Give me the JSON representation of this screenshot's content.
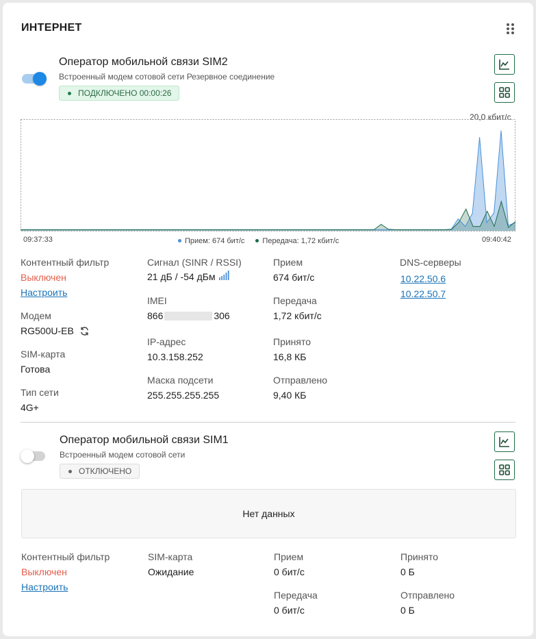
{
  "header": {
    "title": "ИНТЕРНЕТ"
  },
  "sim2": {
    "title": "Оператор мобильной связи SIM2",
    "subtitle": "Встроенный модем сотовой сети Резервное соединение",
    "status": "ПОДКЛЮЧЕНО 00:00:26",
    "enabled": true,
    "chart": {
      "max_label": "20,0 кбит/с",
      "start_time": "09:37:33",
      "end_time": "09:40:42",
      "legend": [
        {
          "label": "Прием:",
          "value": "674 бит/с",
          "color": "#4a90d9"
        },
        {
          "label": "Передача:",
          "value": "1,72 кбит/с",
          "color": "#1f6b47"
        }
      ]
    },
    "chart_data": {
      "type": "area",
      "ylim": [
        0,
        20
      ],
      "unit": "кбит/с",
      "series": [
        {
          "name": "Прием",
          "values": [
            0.2,
            0.2,
            0.2,
            0.2,
            0.2,
            0.2,
            0.2,
            0.2,
            0.2,
            0.2,
            0.2,
            0.2,
            0.2,
            0.2,
            0.2,
            0.2,
            0.2,
            0.2,
            0.2,
            0.2,
            0.2,
            0.2,
            0.2,
            0.2,
            0.2,
            0.2,
            0.2,
            0.2,
            0.2,
            0.2,
            0.2,
            0.2,
            0.2,
            0.2,
            0.2,
            0.2,
            0.2,
            0.2,
            0.2,
            0.2,
            0.2,
            0.2,
            0.2,
            0.2,
            0.2,
            0.2,
            0.2,
            0.2,
            0.2,
            0.2,
            0.2,
            0.2,
            0.2,
            0.2,
            0.2,
            0.2,
            0.2,
            0.2,
            0.2,
            0.2,
            0.2,
            2.2,
            0.8,
            3.2,
            17.2,
            1.5,
            3.3,
            18.4,
            1.0,
            1.5
          ]
        },
        {
          "name": "Передача",
          "values": [
            0.2,
            0.2,
            0.2,
            0.2,
            0.2,
            0.2,
            0.2,
            0.2,
            0.2,
            0.2,
            0.2,
            0.2,
            0.2,
            0.2,
            0.2,
            0.2,
            0.2,
            0.2,
            0.2,
            0.2,
            0.2,
            0.2,
            0.2,
            0.2,
            0.2,
            0.2,
            0.2,
            0.2,
            0.2,
            0.2,
            0.2,
            0.2,
            0.2,
            0.2,
            0.2,
            0.2,
            0.2,
            0.2,
            0.2,
            0.2,
            0.2,
            0.2,
            0.2,
            0.2,
            0.2,
            0.2,
            0.2,
            0.2,
            0.2,
            0.2,
            0.2,
            1.2,
            0.3,
            0.2,
            0.2,
            0.2,
            0.2,
            0.2,
            0.2,
            0.2,
            0.2,
            0.3,
            1.6,
            4.0,
            0.8,
            0.8,
            3.6,
            0.8,
            5.4,
            0.6,
            1.7
          ]
        }
      ]
    },
    "stats": {
      "content_filter": {
        "label": "Контентный фильтр",
        "value": "Выключен",
        "link": "Настроить"
      },
      "modem": {
        "label": "Модем",
        "value": "RG500U-EB"
      },
      "sim": {
        "label": "SIM-карта",
        "value": "Готова"
      },
      "net_type": {
        "label": "Тип сети",
        "value": "4G+"
      },
      "signal": {
        "label": "Сигнал (SINR / RSSI)",
        "value": "21 дБ / -54 дБм"
      },
      "imei": {
        "label": "IMEI",
        "prefix": "866",
        "suffix": "306"
      },
      "ip": {
        "label": "IP-адрес",
        "value": "10.3.158.252"
      },
      "mask": {
        "label": "Маска подсети",
        "value": "255.255.255.255"
      },
      "rx": {
        "label": "Прием",
        "value": "674 бит/с"
      },
      "tx": {
        "label": "Передача",
        "value": "1,72 кбит/с"
      },
      "received": {
        "label": "Принято",
        "value": "16,8 КБ"
      },
      "sent": {
        "label": "Отправлено",
        "value": "9,40 КБ"
      },
      "dns": {
        "label": "DNS-серверы",
        "servers": [
          "10.22.50.6",
          "10.22.50.7"
        ]
      }
    }
  },
  "sim1": {
    "title": "Оператор мобильной связи SIM1",
    "subtitle": "Встроенный модем сотовой сети",
    "status": "ОТКЛЮЧЕНО",
    "enabled": false,
    "nodata": "Нет данных",
    "stats": {
      "content_filter": {
        "label": "Контентный фильтр",
        "value": "Выключен",
        "link": "Настроить"
      },
      "sim": {
        "label": "SIM-карта",
        "value": "Ожидание"
      },
      "rx": {
        "label": "Прием",
        "value": "0 бит/с"
      },
      "tx": {
        "label": "Передача",
        "value": "0 бит/с"
      },
      "received": {
        "label": "Принято",
        "value": "0 Б"
      },
      "sent": {
        "label": "Отправлено",
        "value": "0 Б"
      }
    }
  },
  "colors": {
    "rx": "#4a90d9",
    "tx": "#1f6b47",
    "accent": "#1e88e5",
    "error": "#e45d4a",
    "link": "#1a73b8"
  },
  "icons": {
    "chart": "line-chart-icon",
    "grid": "grid-icon",
    "menu": "drag-dots-icon",
    "signal": "signal-bars-icon",
    "refresh": "refresh-icon"
  }
}
